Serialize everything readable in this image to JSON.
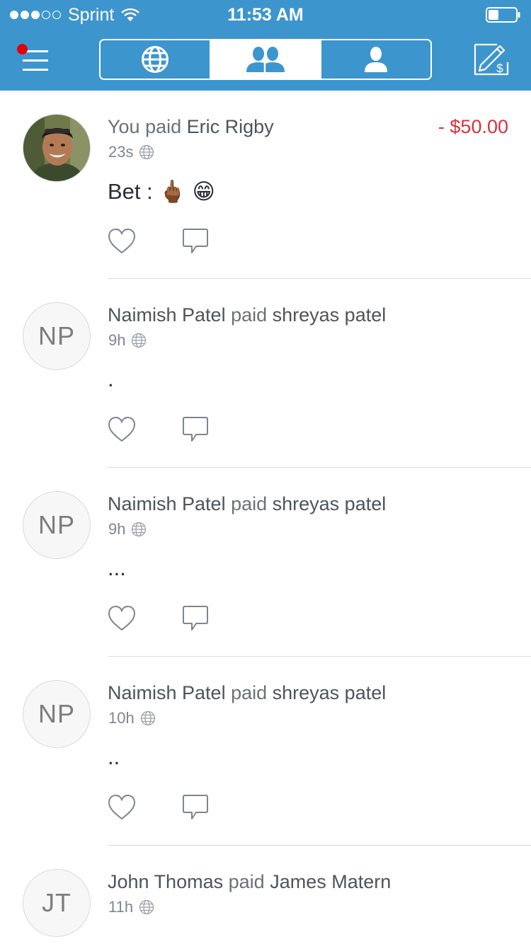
{
  "status_bar": {
    "carrier": "Sprint",
    "time": "11:53 AM",
    "signal_bars_filled": 3,
    "signal_bars_total": 5,
    "battery_level": 0.35
  },
  "nav": {
    "menu_icon": "hamburger-menu-icon",
    "tabs": [
      {
        "name": "public",
        "icon": "globe-icon",
        "active": false
      },
      {
        "name": "friends",
        "icon": "friends-icon",
        "active": true
      },
      {
        "name": "personal",
        "icon": "person-icon",
        "active": false
      }
    ],
    "pay_icon": "pay-or-request-icon"
  },
  "colors": {
    "brand_blue": "#3d95ce",
    "amount_red": "#d9323c",
    "notification_dot": "#e3000f"
  },
  "feed": [
    {
      "actor_prefix": "You paid",
      "actor": "",
      "verb": "",
      "target": "Eric Rigby",
      "amount": "- $50.00",
      "time": "23s",
      "note": "Bet : 🖕🏾 😁",
      "avatar_initials": ""
    },
    {
      "actor_prefix": "",
      "actor": "Naimish Patel",
      "verb": "paid",
      "target": "shreyas patel",
      "amount": "",
      "time": "9h",
      "note": ".",
      "avatar_initials": "NP"
    },
    {
      "actor_prefix": "",
      "actor": "Naimish Patel",
      "verb": "paid",
      "target": "shreyas patel",
      "amount": "",
      "time": "9h",
      "note": "...",
      "avatar_initials": "NP"
    },
    {
      "actor_prefix": "",
      "actor": "Naimish Patel",
      "verb": "paid",
      "target": "shreyas patel",
      "amount": "",
      "time": "10h",
      "note": "..",
      "avatar_initials": "NP"
    },
    {
      "actor_prefix": "",
      "actor": "John Thomas",
      "verb": "paid",
      "target": "James Matern",
      "amount": "",
      "time": "11h",
      "note": "",
      "avatar_initials": "JT"
    }
  ]
}
